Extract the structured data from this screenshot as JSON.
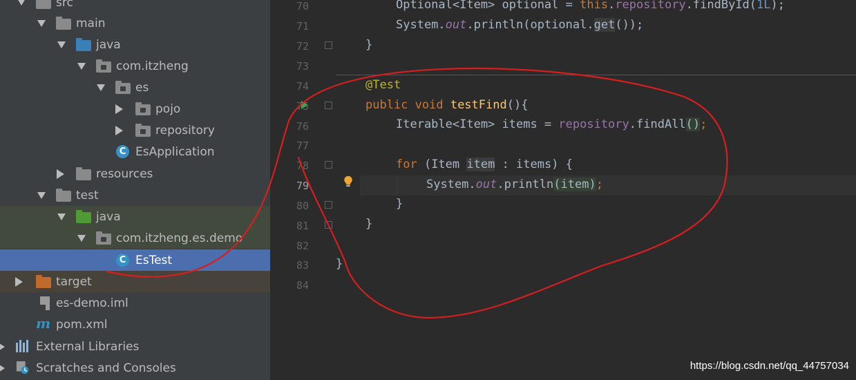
{
  "tree": {
    "src": "src",
    "main": "main",
    "java_main": "java",
    "pkg_main": "com.itzheng",
    "es": "es",
    "pojo": "pojo",
    "repository": "repository",
    "es_application": "EsApplication",
    "resources": "resources",
    "test": "test",
    "java_test": "java",
    "pkg_test": "com.itzheng.es.demo",
    "es_test": "EsTest",
    "target": "target",
    "iml": "es-demo.iml",
    "pom": "pom.xml",
    "ext_libs": "External Libraries",
    "scratches": "Scratches and Consoles",
    "class_glyph": "C"
  },
  "editor": {
    "line_numbers": [
      "70",
      "71",
      "72",
      "73",
      "74",
      "75",
      "76",
      "77",
      "78",
      "79",
      "80",
      "81",
      "82",
      "83",
      "84"
    ],
    "current_line": "79",
    "code": {
      "l70": [
        "Optional<Item> optional = ",
        "this",
        ".",
        "repository",
        ".findById(",
        "1L",
        ");"
      ],
      "l71": [
        "System.",
        "out",
        ".println(optional.",
        "get",
        "());"
      ],
      "l72": "}",
      "l74": "@Test",
      "l75": [
        "public void ",
        "testFind",
        "(){"
      ],
      "l76": [
        "Iterable<Item> items = ",
        "repository",
        ".findAll",
        "(",
        ")",
        ";"
      ],
      "l78": [
        "for ",
        "(Item ",
        "item",
        " : items) ",
        "{"
      ],
      "l79": [
        "System.",
        "out",
        ".println",
        "(",
        "item",
        ")",
        ";"
      ],
      "l80": "}",
      "l81": "}",
      "l83": "}"
    }
  },
  "watermark": "https://blog.csdn.net/qq_44757034",
  "colors": {
    "keyword": "#cc7832",
    "annotation": "#bbb529",
    "method": "#ffc66d",
    "field": "#9876aa",
    "number": "#6897bb",
    "selection": "#4b6eaf",
    "red_annotation": "#d81e1e"
  },
  "icons": [
    "folder-icon",
    "package-icon",
    "class-icon",
    "spring-class-icon",
    "iml-file-icon",
    "maven-icon",
    "libraries-icon",
    "scratches-icon",
    "run-gutter-icon",
    "bulb-icon",
    "fold-icon"
  ]
}
